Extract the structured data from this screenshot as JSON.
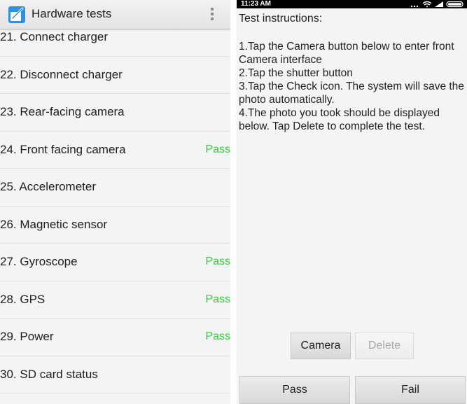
{
  "left": {
    "app_title": "Hardware tests",
    "icons": {
      "app": "hardware-test-app-icon",
      "menu": "overflow-menu-icon"
    },
    "pass_color": "#2dd436",
    "items": [
      {
        "label": "21. Connect charger",
        "status": ""
      },
      {
        "label": "22. Disconnect charger",
        "status": ""
      },
      {
        "label": "23. Rear-facing camera",
        "status": ""
      },
      {
        "label": "24. Front facing camera",
        "status": "Pass"
      },
      {
        "label": "25. Accelerometer",
        "status": ""
      },
      {
        "label": "26. Magnetic sensor",
        "status": ""
      },
      {
        "label": "27. Gyroscope",
        "status": "Pass"
      },
      {
        "label": "28. GPS",
        "status": "Pass"
      },
      {
        "label": "29. Power",
        "status": "Pass"
      },
      {
        "label": "30. SD card status",
        "status": ""
      }
    ]
  },
  "right": {
    "status_bar": {
      "time": "11:23 AM",
      "icons": [
        "more-dots-icon",
        "wifi-icon",
        "signal-icon",
        "battery-icon"
      ]
    },
    "instructions_title": "Test instructions:",
    "instructions": [
      "1.Tap the Camera button below to enter front Camera interface",
      "2.Tap the shutter button",
      "3.Tap the Check icon. The system will save the photo automatically.",
      "4.The photo you took should be displayed below. Tap Delete to complete the test."
    ],
    "buttons": {
      "camera": "Camera",
      "delete": "Delete",
      "pass": "Pass",
      "fail": "Fail"
    }
  }
}
